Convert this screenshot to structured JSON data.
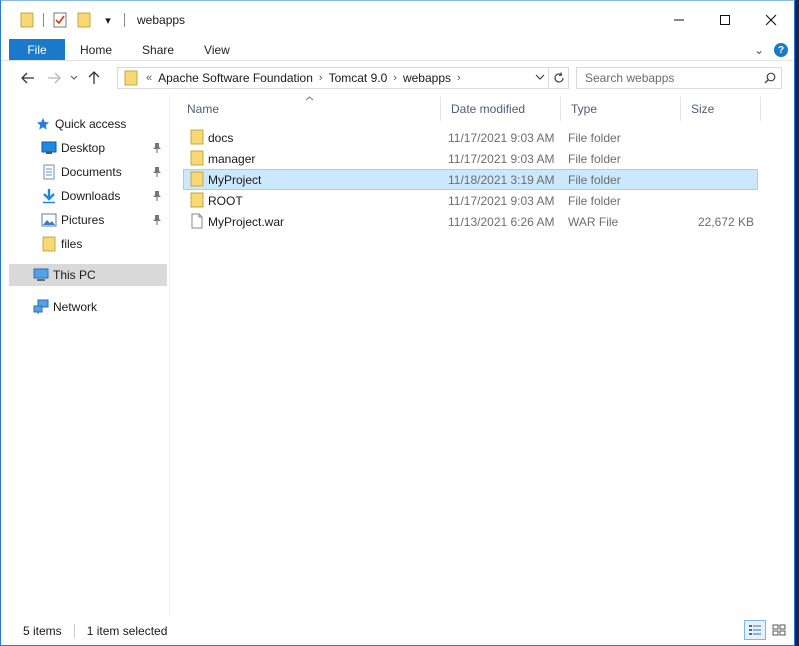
{
  "window": {
    "title": "webapps"
  },
  "titlebar": {
    "qat_customize_glyph": "▾"
  },
  "ribbon": {
    "tabs": [
      "File",
      "Home",
      "Share",
      "View"
    ],
    "expand_glyph": "⌄",
    "help_glyph": "?"
  },
  "address": {
    "overflow": "«",
    "crumbs": [
      "Apache Software Foundation",
      "Tomcat 9.0",
      "webapps"
    ],
    "separator": "›"
  },
  "search": {
    "placeholder": "Search webapps"
  },
  "nav": {
    "items": [
      {
        "label": "Quick access",
        "icon": "star-icon"
      },
      {
        "label": "Desktop",
        "icon": "desktop-icon",
        "pinned": true
      },
      {
        "label": "Documents",
        "icon": "documents-icon",
        "pinned": true
      },
      {
        "label": "Downloads",
        "icon": "downloads-icon",
        "pinned": true
      },
      {
        "label": "Pictures",
        "icon": "pictures-icon",
        "pinned": true
      },
      {
        "label": "files",
        "icon": "folder-icon"
      },
      {
        "label": "This PC",
        "icon": "computer-icon",
        "selected": true
      },
      {
        "label": "Network",
        "icon": "network-icon"
      }
    ]
  },
  "columns": {
    "name": "Name",
    "date": "Date modified",
    "type": "Type",
    "size": "Size"
  },
  "files": [
    {
      "name": "docs",
      "date": "11/17/2021 9:03 AM",
      "type": "File folder",
      "size": "",
      "icon": "folder-icon"
    },
    {
      "name": "manager",
      "date": "11/17/2021 9:03 AM",
      "type": "File folder",
      "size": "",
      "icon": "folder-icon"
    },
    {
      "name": "MyProject",
      "date": "11/18/2021 3:19 AM",
      "type": "File folder",
      "size": "",
      "icon": "folder-icon",
      "selected": true
    },
    {
      "name": "ROOT",
      "date": "11/17/2021 9:03 AM",
      "type": "File folder",
      "size": "",
      "icon": "folder-icon"
    },
    {
      "name": "MyProject.war",
      "date": "11/13/2021 6:26 AM",
      "type": "WAR File",
      "size": "22,672 KB",
      "icon": "file-icon"
    }
  ],
  "status": {
    "count": "5 items",
    "selection": "1 item selected"
  },
  "colors": {
    "accent": "#1979ca",
    "selection_bg": "#cce8ff",
    "selection_border": "#99d1ff",
    "folder": "#f8d775"
  }
}
